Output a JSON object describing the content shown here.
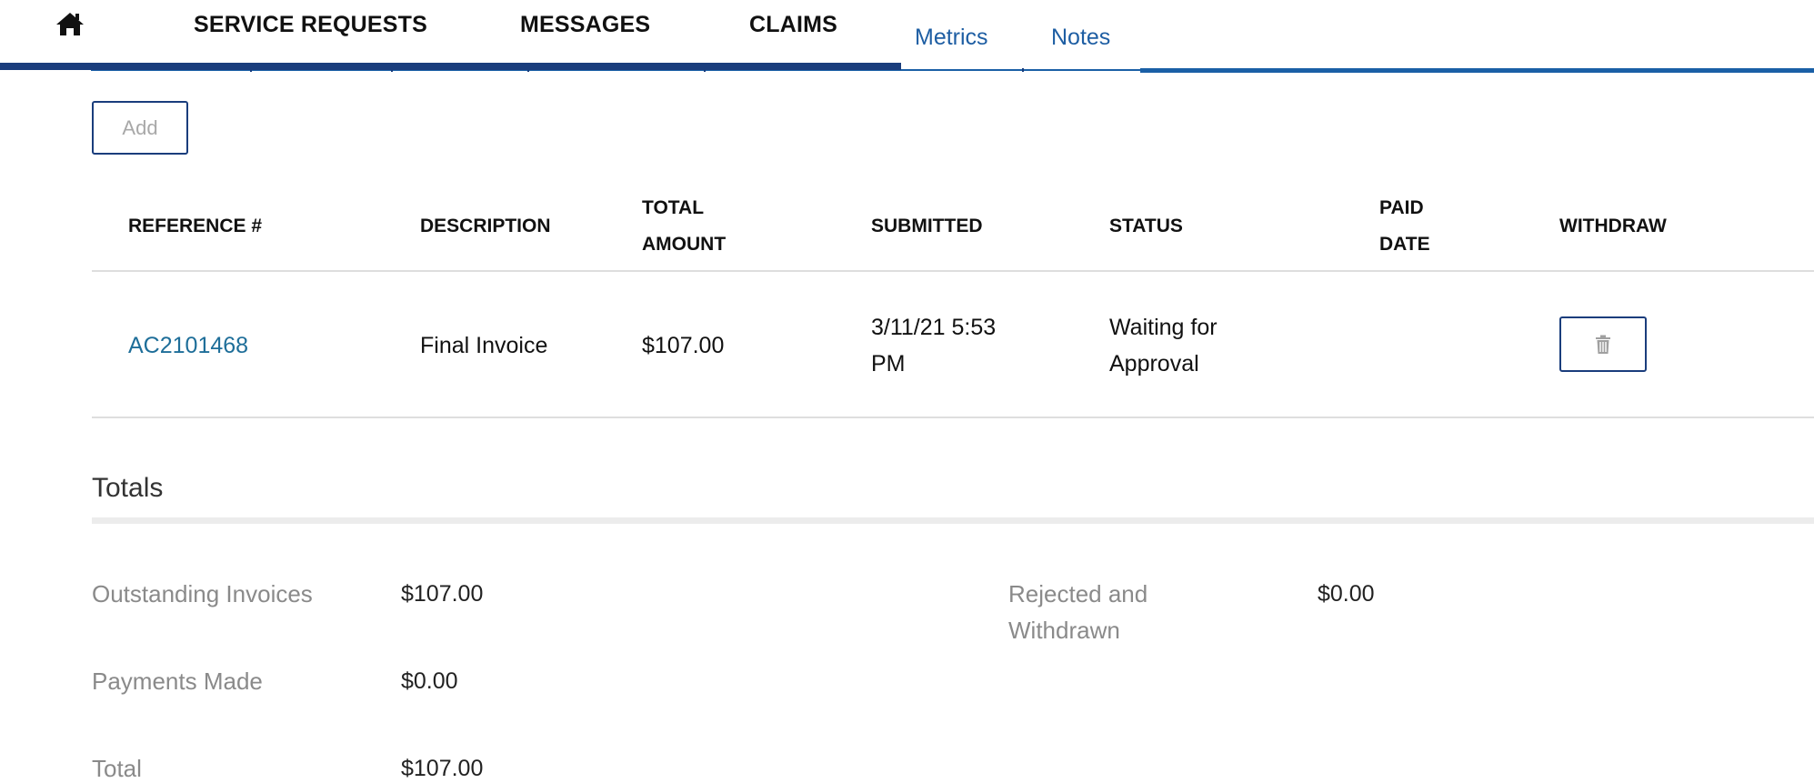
{
  "nav": {
    "home_icon": "home-icon",
    "items": [
      {
        "label": "SERVICE REQUESTS"
      },
      {
        "label": "MESSAGES"
      },
      {
        "label": "CLAIMS"
      }
    ],
    "sub_tabs": [
      {
        "label": "Metrics"
      },
      {
        "label": "Notes"
      }
    ]
  },
  "toolbar": {
    "add_label": "Add"
  },
  "table": {
    "headers": {
      "reference": "REFERENCE #",
      "description": "DESCRIPTION",
      "total_amount_1": "TOTAL",
      "total_amount_2": "AMOUNT",
      "submitted": "SUBMITTED",
      "status": "STATUS",
      "paid_date_1": "PAID",
      "paid_date_2": "DATE",
      "withdraw": "WITHDRAW"
    },
    "rows": [
      {
        "reference": "AC2101468",
        "description": "Final Invoice",
        "total_amount": "$107.00",
        "submitted_1": "3/11/21 5:53",
        "submitted_2": "PM",
        "status_1": "Waiting for",
        "status_2": "Approval",
        "paid_date": "",
        "withdraw_icon": "trash-icon"
      }
    ]
  },
  "totals": {
    "title": "Totals",
    "outstanding_label": "Outstanding Invoices",
    "outstanding_value": "$107.00",
    "payments_label": "Payments Made",
    "payments_value": "$0.00",
    "total_label": "Total",
    "total_value": "$107.00",
    "rejected_label_1": "Rejected and",
    "rejected_label_2": "Withdrawn",
    "rejected_value": "$0.00"
  },
  "colors": {
    "nav_bar": "#1a3d7c",
    "accent": "#1a5fa6",
    "link": "#1e6e99",
    "muted_label": "#8a8a8a"
  }
}
